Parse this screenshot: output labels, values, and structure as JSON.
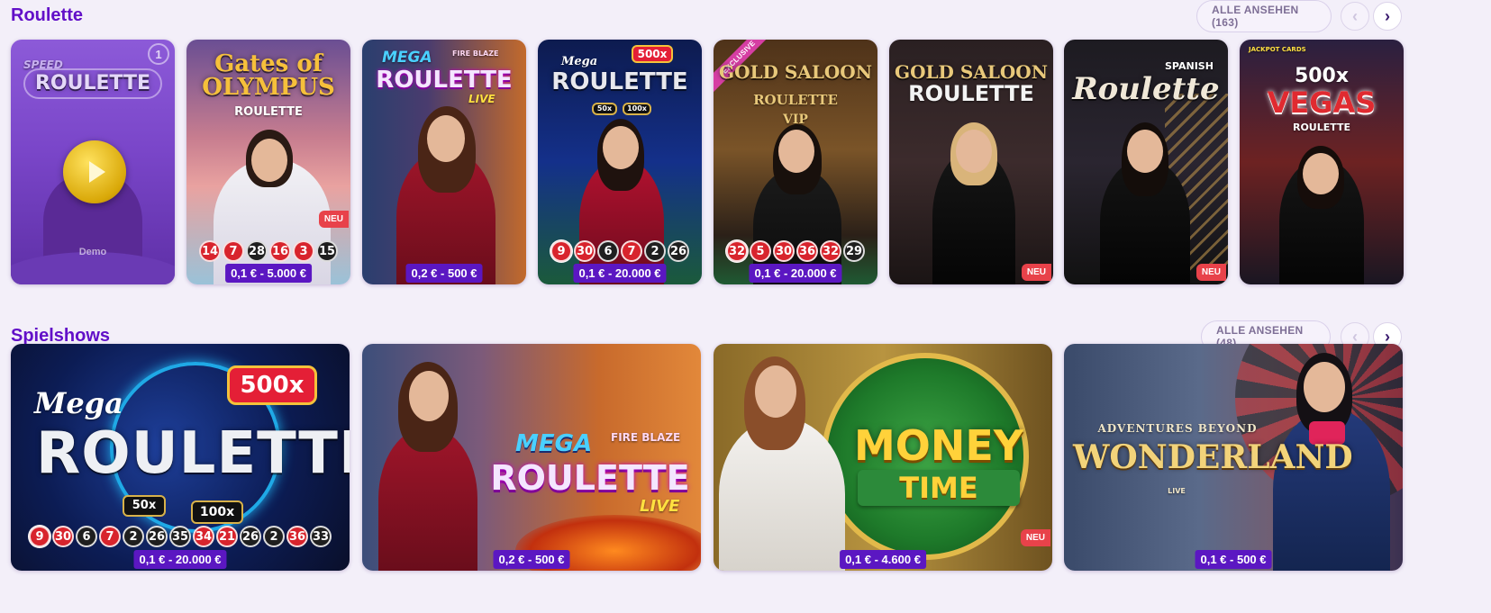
{
  "roulette": {
    "title": "Roulette",
    "view_all": "ALLE ANSEHEN (163)",
    "cards": [
      {
        "title": "ROULETTE",
        "sub": "SPEED",
        "badge": "1",
        "demo": "Demo"
      },
      {
        "title": "Gates of OLYMPUS",
        "sub": "ROULETTE",
        "results": [
          "14",
          "7",
          "28",
          "16",
          "3",
          "15"
        ],
        "colors": [
          "red",
          "red",
          "black",
          "red",
          "red",
          "black"
        ],
        "bet": "0,1 € - 5.000 €",
        "new": "NEU"
      },
      {
        "title": "ROULETTE",
        "sub": "MEGA",
        "sub2": "FIRE BLAZE",
        "sub3": "LIVE",
        "bet": "0,2 € - 500 €"
      },
      {
        "title": "ROULETTE",
        "sub": "Mega",
        "mult": "500x",
        "m1": "50x",
        "m2": "100x",
        "results": [
          "9",
          "30",
          "6",
          "7",
          "2",
          "26"
        ],
        "colors": [
          "red",
          "red",
          "black",
          "red",
          "black",
          "black"
        ],
        "bet": "0,1 € - 20.000 €"
      },
      {
        "title": "GOLD SALOON",
        "sub": "ROULETTE",
        "sub2": "VIP",
        "exclusive": "EXCLUSIVE",
        "results": [
          "32",
          "5",
          "30",
          "36",
          "32",
          "29"
        ],
        "colors": [
          "red",
          "red",
          "red",
          "red",
          "red",
          "black"
        ],
        "bet": "0,1 € - 20.000 €"
      },
      {
        "title": "GOLD SALOON",
        "sub": "ROULETTE",
        "new": "NEU"
      },
      {
        "title": "Roulette",
        "sub": "SPANISH",
        "new": "NEU"
      },
      {
        "title": "VEGAS",
        "sub": "500x",
        "sub2": "ROULETTE",
        "sub3": "JACKPOT CARDS"
      }
    ]
  },
  "shows": {
    "title": "Spielshows",
    "view_all": "ALLE ANSEHEN (48)",
    "cards": [
      {
        "title": "ROULETTE",
        "sub": "Mega",
        "mult": "500x",
        "m1": "50x",
        "m2": "100x",
        "results": [
          "9",
          "30",
          "6",
          "7",
          "2",
          "26",
          "35",
          "34",
          "21",
          "26",
          "2",
          "36",
          "33"
        ],
        "colors": [
          "red",
          "red",
          "black",
          "red",
          "black",
          "black",
          "black",
          "red",
          "red",
          "black",
          "black",
          "red",
          "black"
        ],
        "bet": "0,1 € - 20.000 €"
      },
      {
        "title": "ROULETTE",
        "sub": "MEGA",
        "sub2": "FIRE BLAZE",
        "sub3": "LIVE",
        "bet": "0,2 € - 500 €"
      },
      {
        "title": "MONEY",
        "sub": "TIME",
        "new": "NEU",
        "bet": "0,1 € - 4.600 €"
      },
      {
        "title": "WONDERLAND",
        "sub": "ADVENTURES BEYOND",
        "sub2": "LIVE",
        "bet": "0,1 € - 500 €"
      }
    ]
  },
  "nav": {
    "prev": "‹",
    "next": "›"
  }
}
